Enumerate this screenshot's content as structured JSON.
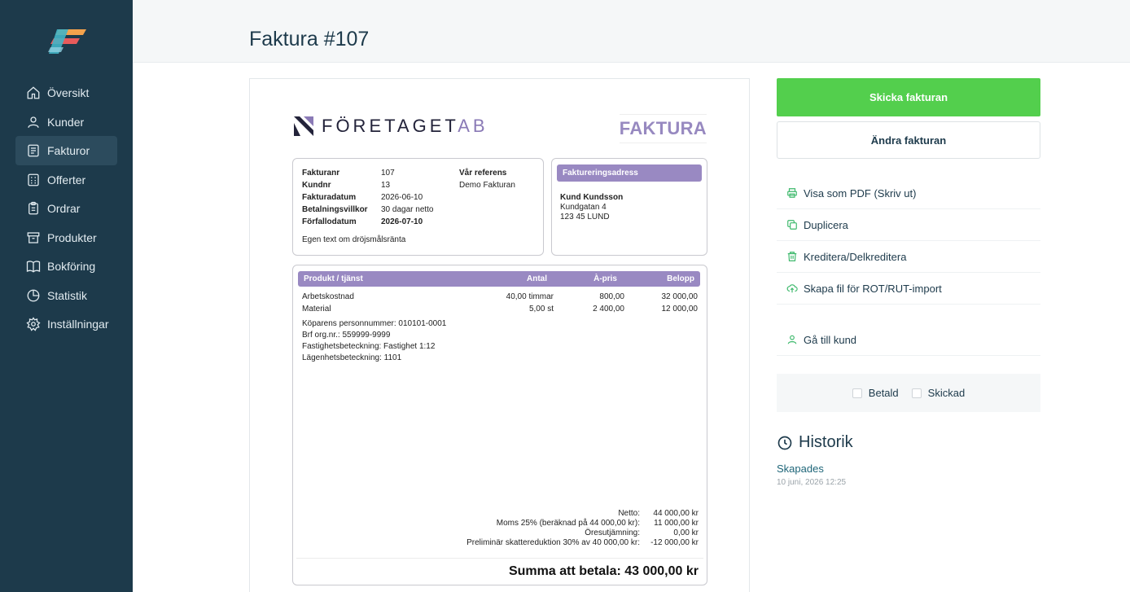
{
  "sidebar": {
    "items": [
      {
        "label": "Översikt",
        "icon": "home-icon"
      },
      {
        "label": "Kunder",
        "icon": "user-icon"
      },
      {
        "label": "Fakturor",
        "icon": "document-icon",
        "active": true
      },
      {
        "label": "Offerter",
        "icon": "calculator-icon"
      },
      {
        "label": "Ordrar",
        "icon": "clipboard-icon"
      },
      {
        "label": "Produkter",
        "icon": "archive-icon"
      },
      {
        "label": "Bokföring",
        "icon": "book-icon"
      },
      {
        "label": "Statistik",
        "icon": "pie-chart-icon"
      },
      {
        "label": "Inställningar",
        "icon": "gear-icon"
      }
    ]
  },
  "header": {
    "title": "Faktura #107"
  },
  "invoice": {
    "brand_main": "FÖRETAGET",
    "brand_suffix": "AB",
    "doc_label": "FAKTURA",
    "info": {
      "rows": [
        {
          "key": "Fakturanr",
          "value": "107"
        },
        {
          "key": "Kundnr",
          "value": "13"
        },
        {
          "key": "Fakturadatum",
          "value": "2026-06-10"
        },
        {
          "key": "Betalningsvillkor",
          "value": "30 dagar netto"
        },
        {
          "key": "Förfallodatum",
          "value": "2026-07-10"
        }
      ],
      "ref_label": "Vår referens",
      "ref_value": "Demo Fakturan",
      "note": "Egen text om dröjsmålsränta"
    },
    "address": {
      "heading": "Faktureringsadress",
      "name": "Kund Kundsson",
      "street": "Kundgatan 4",
      "city": "123 45 LUND"
    },
    "items": {
      "headers": {
        "product": "Produkt / tjänst",
        "qty": "Antal",
        "price": "À-pris",
        "amount": "Belopp"
      },
      "rows": [
        {
          "product": "Arbetskostnad",
          "qty": "40,00 timmar",
          "price": "800,00",
          "amount": "32 000,00"
        },
        {
          "product": "Material",
          "qty": "5,00 st",
          "price": "2 400,00",
          "amount": "12 000,00"
        }
      ],
      "notes": [
        "Köparens personnummer: 010101-0001",
        "Brf org.nr.: 559999-9999",
        "Fastighetsbeteckning: Fastighet 1:12",
        "Lägenhetsbeteckning: 1101"
      ]
    },
    "totals": [
      {
        "label": "Netto:",
        "value": "44 000,00 kr"
      },
      {
        "label": "Moms 25% (beräknad på 44 000,00 kr):",
        "value": "11 000,00 kr"
      },
      {
        "label": "Öresutjämning:",
        "value": "0,00 kr"
      },
      {
        "label": "Preliminär skattereduktion 30% av 40 000,00 kr:",
        "value": "-12 000,00 kr"
      }
    ],
    "sum_label": "Summa att betala: 43 000,00 kr"
  },
  "actions": {
    "send": "Skicka fakturan",
    "edit": "Ändra fakturan",
    "pdf": "Visa som PDF (Skriv ut)",
    "duplicate": "Duplicera",
    "credit": "Kreditera/Delkreditera",
    "rot": "Skapa fil för ROT/RUT-import",
    "customer": "Gå till kund"
  },
  "status": {
    "paid": "Betald",
    "sent": "Skickad"
  },
  "history": {
    "title": "Historik",
    "items": [
      {
        "event": "Skapades",
        "time": "10 juni, 2026 12:25"
      }
    ]
  },
  "colors": {
    "sidebar": "#1d3a4b",
    "accent_green": "#53cf4d",
    "invoice_purple": "#9989c2",
    "action_icon": "#3bb86a"
  }
}
